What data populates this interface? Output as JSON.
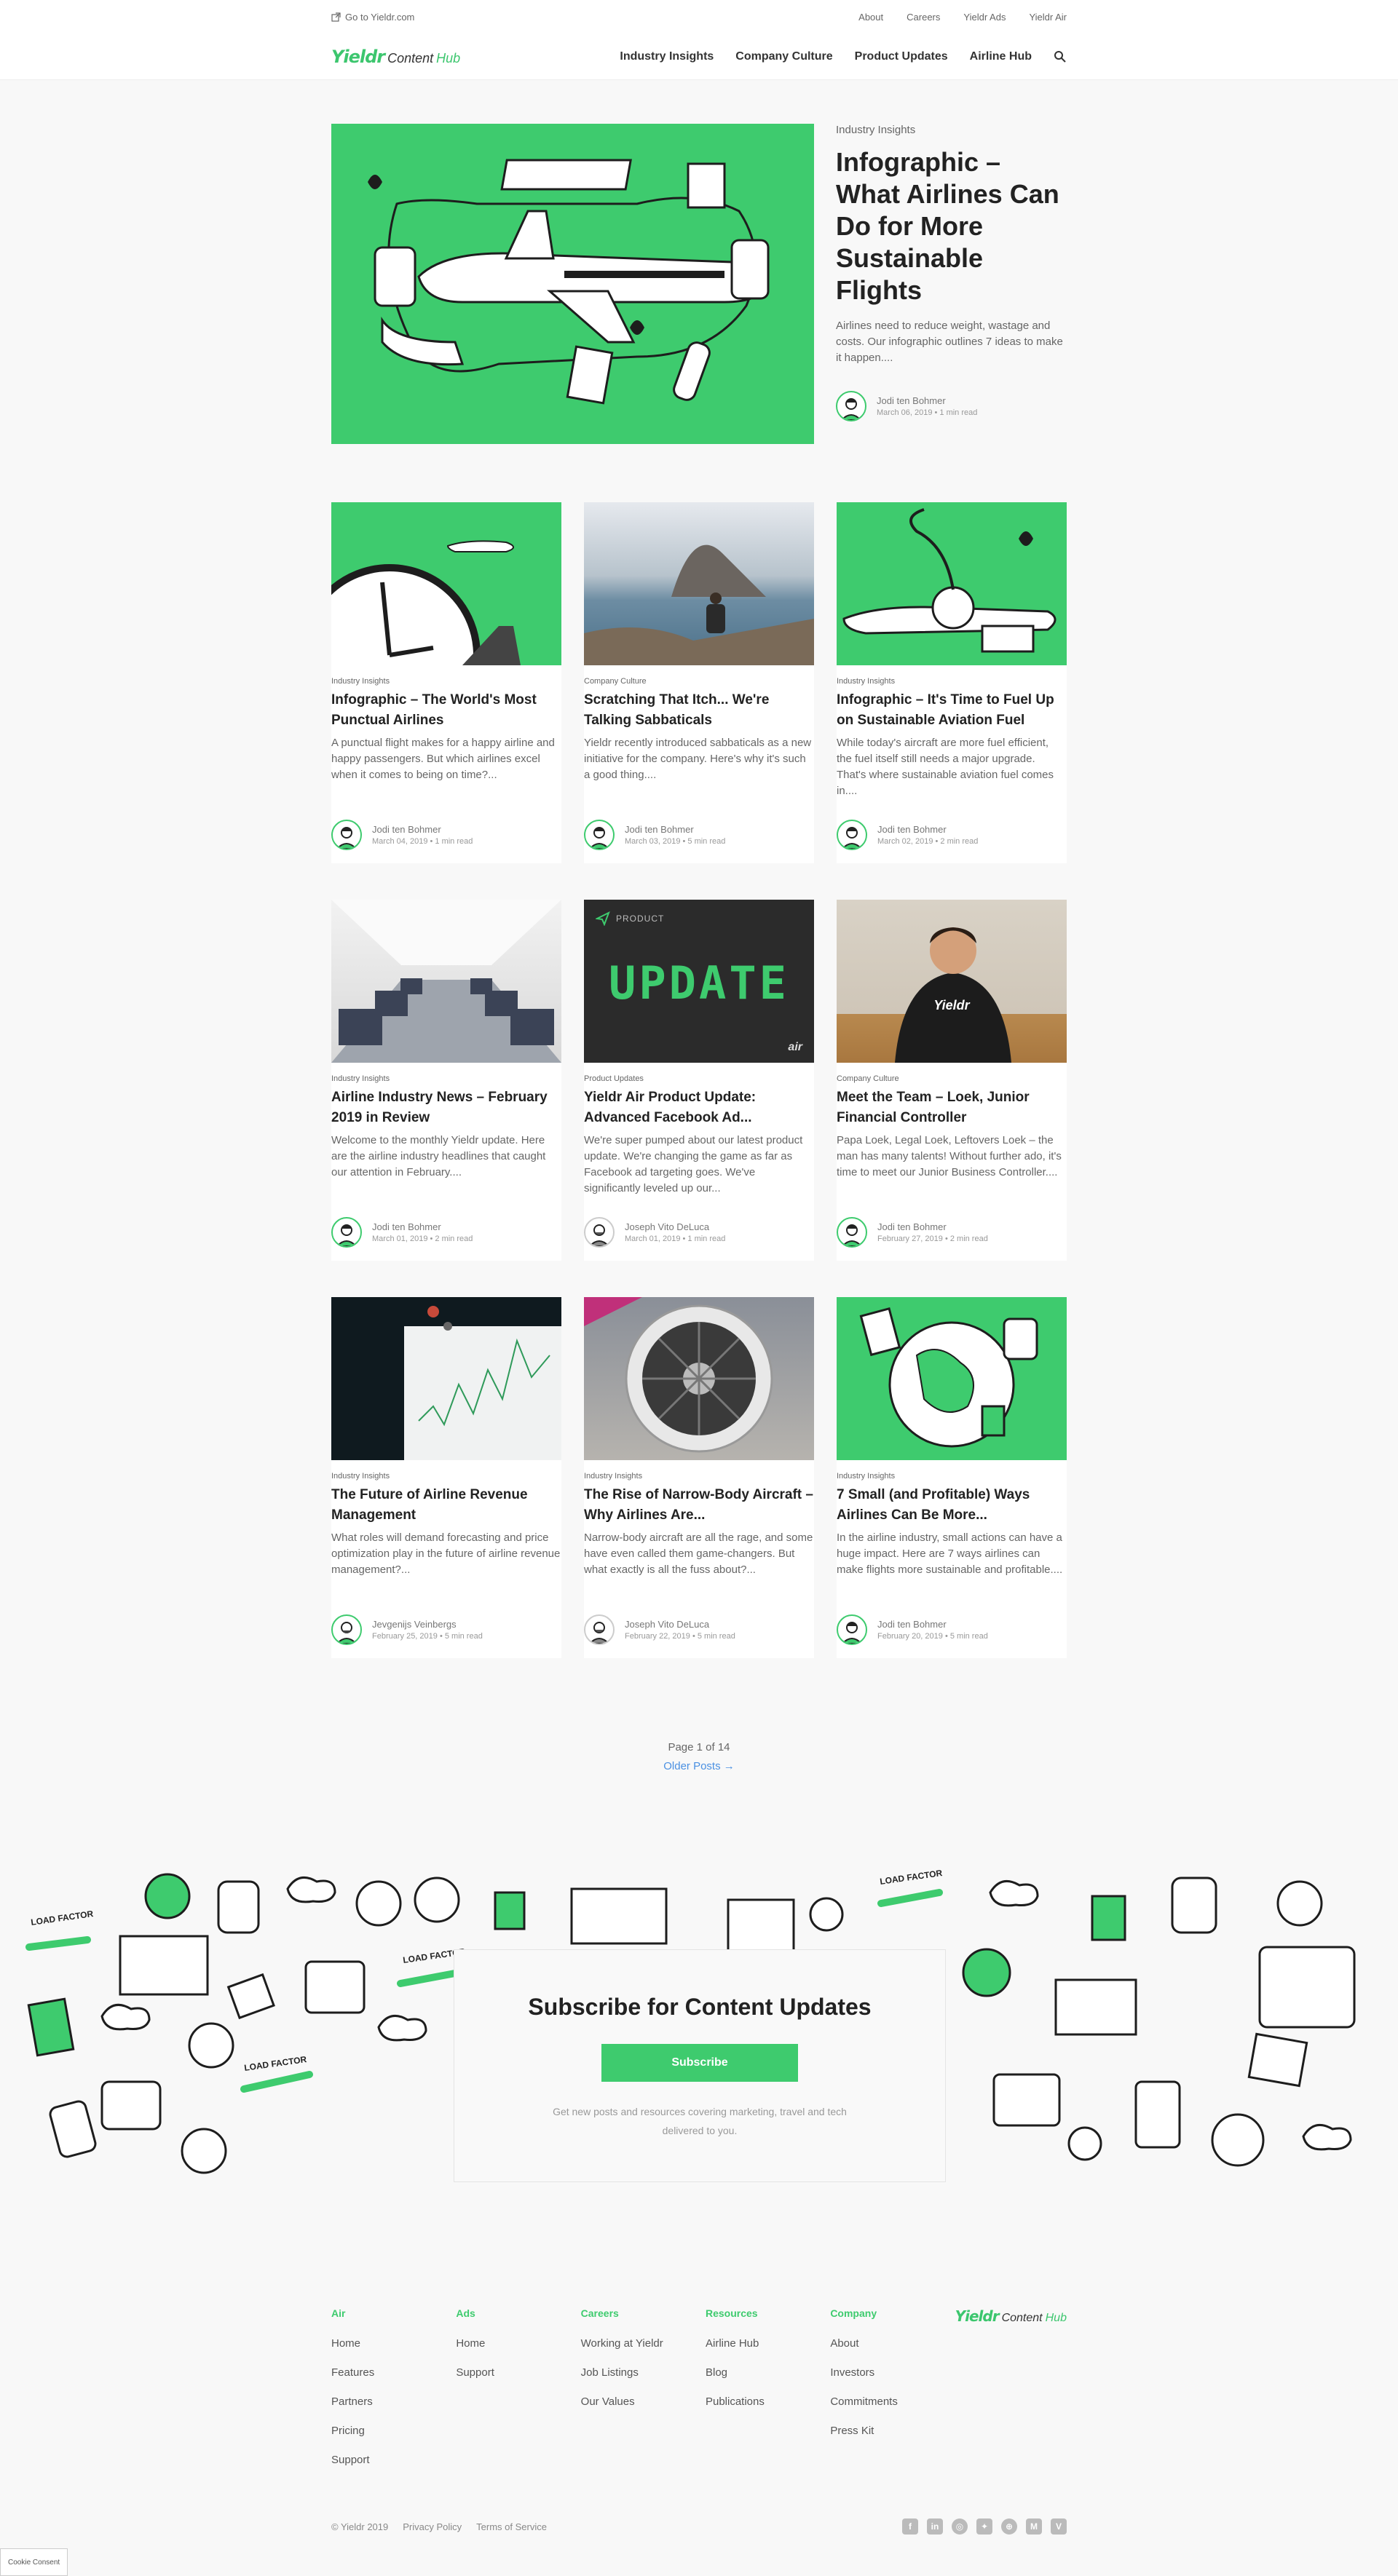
{
  "utility": {
    "go_to": "Go to Yieldr.com",
    "links": [
      "About",
      "Careers",
      "Yieldr Ads",
      "Yieldr Air"
    ]
  },
  "nav": {
    "logo_mark": "Yieldr",
    "logo_text": "Content",
    "logo_hub": "Hub",
    "links": [
      "Industry Insights",
      "Company Culture",
      "Product Updates",
      "Airline Hub"
    ]
  },
  "featured": {
    "category": "Industry Insights",
    "title": "Infographic – What Airlines Can Do for More Sustainable Flights",
    "excerpt": "Airlines need to reduce weight, wastage and costs. Our infographic outlines 7 ideas to make it happen....",
    "author": "Jodi ten Bohmer",
    "meta": "March 06, 2019 • 1 min read"
  },
  "posts": [
    {
      "category": "Industry Insights",
      "title": "Infographic – The World's Most Punctual Airlines",
      "excerpt": "A punctual flight makes for a happy airline and happy passengers. But which airlines excel when it comes to being on time?...",
      "author": "Jodi ten Bohmer",
      "meta": "March 04, 2019 • 1 min read"
    },
    {
      "category": "Company Culture",
      "title": "Scratching That Itch... We're Talking Sabbaticals",
      "excerpt": "Yieldr recently introduced sabbaticals as a new initiative for the company. Here's why it's such a good thing....",
      "author": "Jodi ten Bohmer",
      "meta": "March 03, 2019 • 5 min read"
    },
    {
      "category": "Industry Insights",
      "title": "Infographic – It's Time to Fuel Up on Sustainable Aviation Fuel",
      "excerpt": "While today's aircraft are more fuel efficient, the fuel itself still needs a major upgrade. That's where sustainable aviation fuel comes in....",
      "author": "Jodi ten Bohmer",
      "meta": "March 02, 2019 • 2 min read"
    },
    {
      "category": "Industry Insights",
      "title": "Airline Industry News – February 2019 in Review",
      "excerpt": "Welcome to the monthly Yieldr update. Here are the airline industry headlines that caught our attention in February....",
      "author": "Jodi ten Bohmer",
      "meta": "March 01, 2019 • 2 min read"
    },
    {
      "category": "Product Updates",
      "title": "Yieldr Air Product Update: Advanced Facebook Ad...",
      "excerpt": "We're super pumped about our latest product update. We're changing the game as far as Facebook ad targeting goes. We've significantly leveled up our...",
      "author": "Joseph Vito DeLuca",
      "meta": "March 01, 2019 • 1 min read"
    },
    {
      "category": "Company Culture",
      "title": "Meet the Team – Loek, Junior Financial Controller",
      "excerpt": "Papa Loek, Legal Loek, Leftovers Loek – the man has many talents! Without further ado, it's time to meet our Junior Business Controller....",
      "author": "Jodi ten Bohmer",
      "meta": "February 27, 2019 • 2 min read"
    },
    {
      "category": "Industry Insights",
      "title": "The Future of Airline Revenue Management",
      "excerpt": "What roles will demand forecasting and price optimization play in the future of airline revenue management?...",
      "author": "Jevgenijs Veinbergs",
      "meta": "February 25, 2019 • 5 min read"
    },
    {
      "category": "Industry Insights",
      "title": "The Rise of Narrow-Body Aircraft – Why Airlines Are...",
      "excerpt": "Narrow-body aircraft are all the rage, and some have even called them game-changers. But what exactly is all the fuss about?...",
      "author": "Joseph Vito DeLuca",
      "meta": "February 22, 2019 • 5 min read"
    },
    {
      "category": "Industry Insights",
      "title": "7 Small (and Profitable) Ways Airlines Can Be More...",
      "excerpt": "In the airline industry, small actions can have a huge impact. Here are 7 ways airlines can make flights more sustainable and profitable....",
      "author": "Jodi ten Bohmer",
      "meta": "February 20, 2019 • 5 min read"
    }
  ],
  "post_images": {
    "product_label": "PRODUCT",
    "update_text": "UPDATE",
    "air_text": "air",
    "shirt_text": "Yieldr"
  },
  "pagination": {
    "page": "Page 1 of 14",
    "older": "Older Posts →"
  },
  "subscribe": {
    "title": "Subscribe for Content Updates",
    "button": "Subscribe",
    "note_line1": "Get new posts and resources covering marketing, travel and tech",
    "note_line2": "delivered to you.",
    "doodle_label": "LOAD FACTOR"
  },
  "footer": {
    "columns": [
      {
        "title": "Air",
        "items": [
          "Home",
          "Features",
          "Partners",
          "Pricing",
          "Support"
        ]
      },
      {
        "title": "Ads",
        "items": [
          "Home",
          "Support"
        ]
      },
      {
        "title": "Careers",
        "items": [
          "Working at Yieldr",
          "Job Listings",
          "Our Values"
        ]
      },
      {
        "title": "Resources",
        "items": [
          "Airline Hub",
          "Blog",
          "Publications"
        ]
      },
      {
        "title": "Company",
        "items": [
          "About",
          "Investors",
          "Commitments",
          "Press Kit"
        ]
      }
    ],
    "copyright": "© Yieldr 2019",
    "privacy": "Privacy Policy",
    "terms": "Terms of Service",
    "socials": [
      "facebook-icon",
      "linkedin-icon",
      "instagram-icon",
      "twitter-icon",
      "dribbble-icon",
      "medium-icon",
      "vimeo-icon"
    ]
  },
  "cookie": "Cookie Consent",
  "colors": {
    "brand_green": "#3ecb6e",
    "link_blue": "#4a90e2"
  }
}
